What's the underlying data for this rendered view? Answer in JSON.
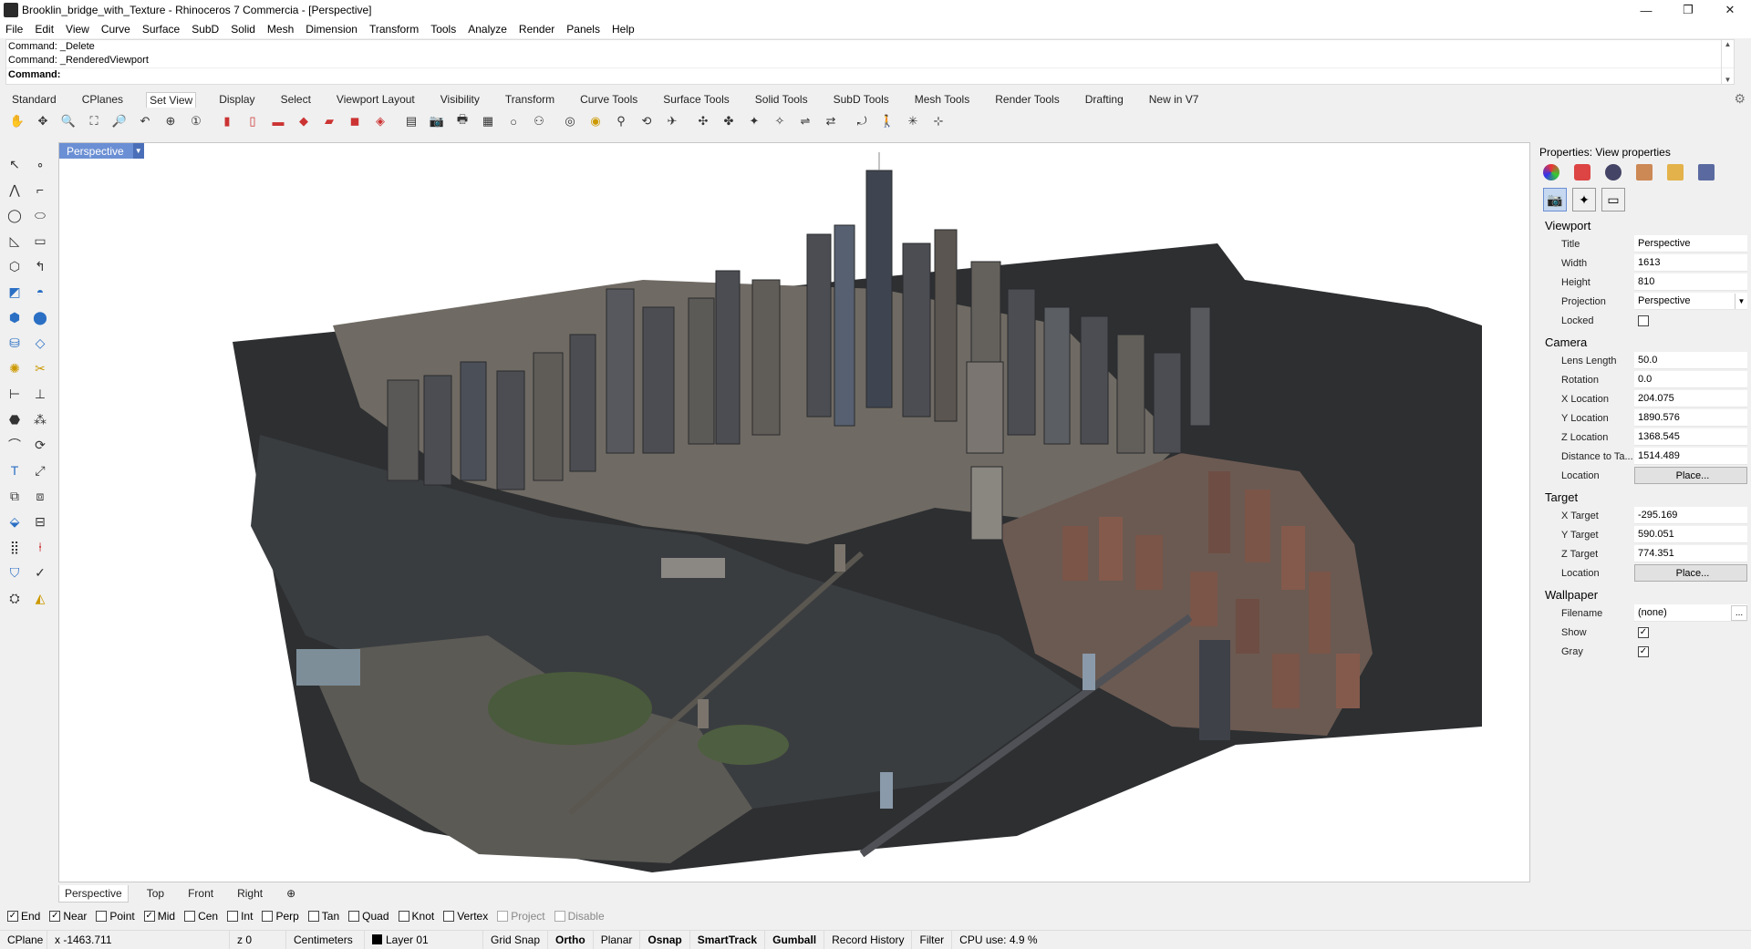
{
  "window": {
    "title": "Brooklin_bridge_with_Texture - Rhinoceros 7 Commercia - [Perspective]",
    "minimize": "—",
    "maximize": "❐",
    "close": "✕"
  },
  "menu": [
    "File",
    "Edit",
    "View",
    "Curve",
    "Surface",
    "SubD",
    "Solid",
    "Mesh",
    "Dimension",
    "Transform",
    "Tools",
    "Analyze",
    "Render",
    "Panels",
    "Help"
  ],
  "command": {
    "history": [
      "Command: _Delete",
      "Command: _RenderedViewport"
    ],
    "prompt": "Command:"
  },
  "tabs": [
    "Standard",
    "CPlanes",
    "Set View",
    "Display",
    "Select",
    "Viewport Layout",
    "Visibility",
    "Transform",
    "Curve Tools",
    "Surface Tools",
    "Solid Tools",
    "SubD Tools",
    "Mesh Tools",
    "Render Tools",
    "Drafting",
    "New in V7"
  ],
  "active_tab": "Set View",
  "viewport": {
    "active_name": "Perspective",
    "bottom_tabs": [
      "Perspective",
      "Top",
      "Front",
      "Right",
      "⊕"
    ]
  },
  "osnaps": [
    {
      "label": "End",
      "checked": true,
      "enabled": true
    },
    {
      "label": "Near",
      "checked": true,
      "enabled": true
    },
    {
      "label": "Point",
      "checked": false,
      "enabled": true
    },
    {
      "label": "Mid",
      "checked": true,
      "enabled": true
    },
    {
      "label": "Cen",
      "checked": false,
      "enabled": true
    },
    {
      "label": "Int",
      "checked": false,
      "enabled": true
    },
    {
      "label": "Perp",
      "checked": false,
      "enabled": true
    },
    {
      "label": "Tan",
      "checked": false,
      "enabled": true
    },
    {
      "label": "Quad",
      "checked": false,
      "enabled": true
    },
    {
      "label": "Knot",
      "checked": false,
      "enabled": true
    },
    {
      "label": "Vertex",
      "checked": false,
      "enabled": true
    },
    {
      "label": "Project",
      "checked": false,
      "enabled": false
    },
    {
      "label": "Disable",
      "checked": false,
      "enabled": false
    }
  ],
  "status": {
    "cplane": "CPlane",
    "x": "x -1463.711",
    "z": "z 0",
    "units": "Centimeters",
    "layer": "Layer 01",
    "toggles": [
      {
        "label": "Grid Snap",
        "bold": false
      },
      {
        "label": "Ortho",
        "bold": true
      },
      {
        "label": "Planar",
        "bold": false
      },
      {
        "label": "Osnap",
        "bold": true
      },
      {
        "label": "SmartTrack",
        "bold": true
      },
      {
        "label": "Gumball",
        "bold": true
      },
      {
        "label": "Record History",
        "bold": false
      },
      {
        "label": "Filter",
        "bold": false
      }
    ],
    "cpu": "CPU use: 4.9 %"
  },
  "properties": {
    "header": "Properties: View properties",
    "viewport_section": "Viewport",
    "title_label": "Title",
    "title_value": "Perspective",
    "width_label": "Width",
    "width_value": "1613",
    "height_label": "Height",
    "height_value": "810",
    "projection_label": "Projection",
    "projection_value": "Perspective",
    "locked_label": "Locked",
    "camera_section": "Camera",
    "lens_label": "Lens Length",
    "lens_value": "50.0",
    "rotation_label": "Rotation",
    "rotation_value": "0.0",
    "xloc_label": "X Location",
    "xloc_value": "204.075",
    "yloc_label": "Y Location",
    "yloc_value": "1890.576",
    "zloc_label": "Z Location",
    "zloc_value": "1368.545",
    "dist_label": "Distance to Ta...",
    "dist_value": "1514.489",
    "loc_label": "Location",
    "place_label": "Place...",
    "target_section": "Target",
    "xt_label": "X Target",
    "xt_value": "-295.169",
    "yt_label": "Y Target",
    "yt_value": "590.051",
    "zt_label": "Z Target",
    "zt_value": "774.351",
    "tloc_label": "Location",
    "tplace_label": "Place...",
    "wallpaper_section": "Wallpaper",
    "filename_label": "Filename",
    "filename_value": "(none)",
    "browse_label": "...",
    "show_label": "Show",
    "gray_label": "Gray"
  },
  "colors": {
    "viewport_tab": "#6b8fd4",
    "water": "#3a3d40",
    "ground": "#2d2f31"
  }
}
